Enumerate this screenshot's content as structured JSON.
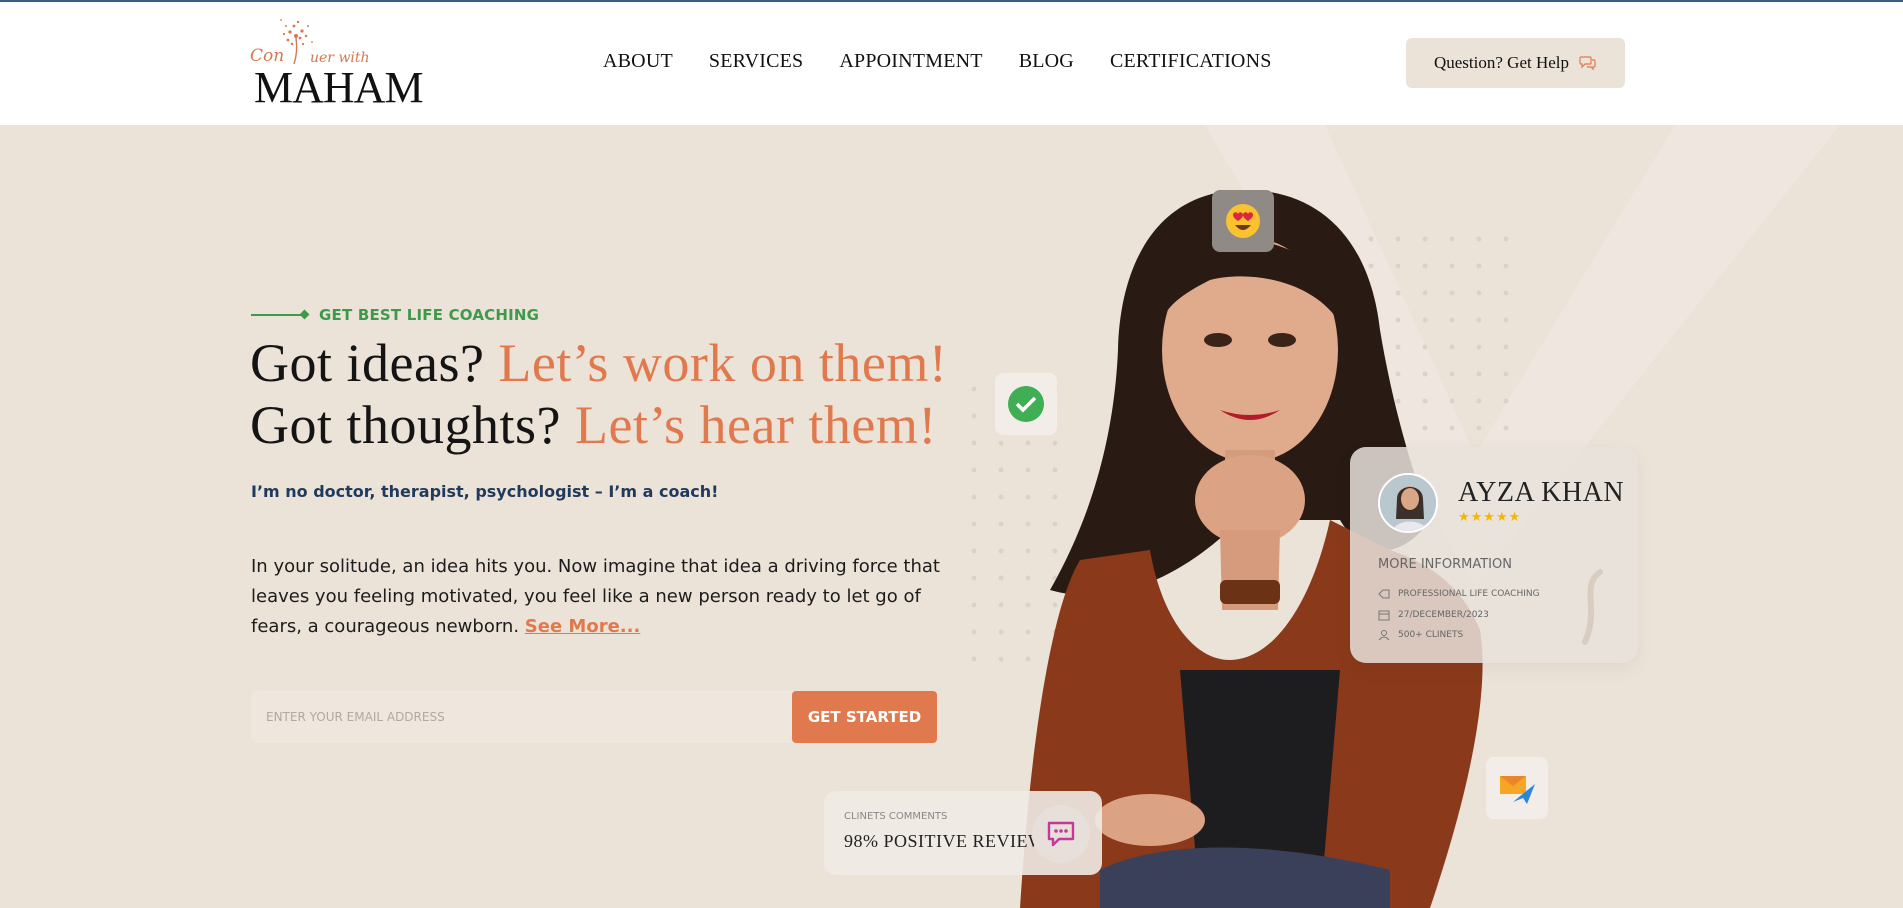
{
  "header": {
    "logo": {
      "script_text": "Con",
      "script_text2": "uer with",
      "name": "MAHAM"
    },
    "nav": [
      {
        "label": "ABOUT"
      },
      {
        "label": "SERVICES"
      },
      {
        "label": "APPOINTMENT"
      },
      {
        "label": "BLOG"
      },
      {
        "label": "CERTIFICATIONS"
      }
    ],
    "help_button": {
      "label": "Question? Get Help",
      "icon": "chat-icon"
    }
  },
  "hero": {
    "eyebrow": "GET BEST LIFE COACHING",
    "headline": {
      "line1_plain": "Got ideas? ",
      "line1_accent": "Let’s work on them!",
      "line2_plain": "Got thoughts? ",
      "line2_accent": "Let’s hear them!"
    },
    "subheading": "I’m no doctor, therapist, psychologist – I’m a coach!",
    "paragraph": "In your solitude, an idea hits you. Now imagine that idea a driving force that leaves you feeling motivated, you feel like a new person ready to let go of fears, a courageous newborn. ",
    "see_more": "See More...",
    "email_form": {
      "placeholder": "ENTER YOUR EMAIL ADDRESS",
      "button_label": "GET STARTED"
    }
  },
  "profile_card": {
    "name": "AYZA KHAN",
    "stars": "★★★★★",
    "section_title": "MORE INFORMATION",
    "items": [
      {
        "icon": "tag-icon",
        "text": "PROFESSIONAL LIFE COACHING"
      },
      {
        "icon": "calendar-icon",
        "text": "27/DECEMBER/2023"
      },
      {
        "icon": "user-icon",
        "text": "500+ CLINETS"
      }
    ]
  },
  "comments_card": {
    "label": "CLINETS COMMENTS",
    "value": "98% POSITIVE REVIEW"
  },
  "badges": [
    {
      "icon": "heart-eyes-emoji-icon"
    },
    {
      "icon": "check-icon"
    },
    {
      "icon": "mail-send-icon"
    }
  ],
  "colors": {
    "accent": "#e07a4e",
    "green": "#3e9a4a",
    "navy": "#1f3a5c",
    "background": "#ebe2d8"
  }
}
